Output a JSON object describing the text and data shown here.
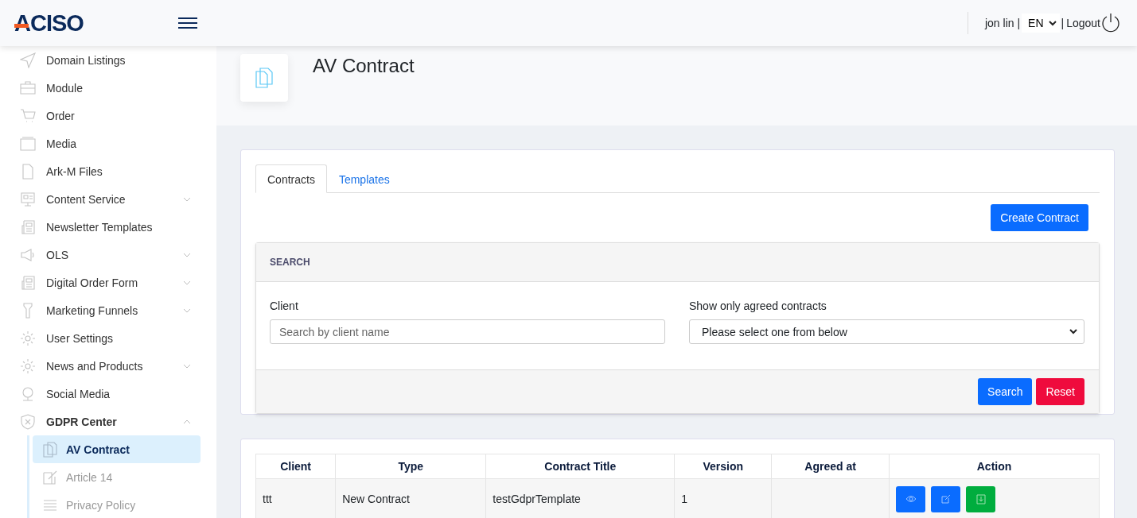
{
  "header": {
    "logo": "ACISO",
    "user": "jon lin |",
    "language": "EN",
    "separator": "|",
    "logout": "Logout"
  },
  "sidebar": {
    "items": [
      {
        "label": "Domain Listings"
      },
      {
        "label": "Module"
      },
      {
        "label": "Order"
      },
      {
        "label": "Media"
      },
      {
        "label": "Ark-M Files"
      },
      {
        "label": "Content Service",
        "expanded": false
      },
      {
        "label": "Newsletter Templates"
      },
      {
        "label": "OLS",
        "expanded": false
      },
      {
        "label": "Digital Order Form",
        "expanded": false
      },
      {
        "label": "Marketing Funnels",
        "expanded": false
      },
      {
        "label": "User Settings"
      },
      {
        "label": "News and Products",
        "expanded": false
      },
      {
        "label": "Social Media"
      },
      {
        "label": "GDPR Center",
        "expanded": true,
        "children": [
          {
            "label": "AV Contract",
            "selected": true
          },
          {
            "label": "Article 14",
            "selected": false
          },
          {
            "label": "Privacy Policy",
            "selected": false
          }
        ]
      }
    ]
  },
  "page": {
    "title": "AV Contract"
  },
  "tabs": [
    {
      "label": "Contracts",
      "selected": true
    },
    {
      "label": "Templates",
      "selected": false
    }
  ],
  "create_button": "Create Contract",
  "search": {
    "title": "SEARCH",
    "client_label": "Client",
    "client_placeholder": "Search by client name",
    "agreed_label": "Show only agreed contracts",
    "agreed_value": "Please select one from below",
    "search_button": "Search",
    "reset_button": "Reset"
  },
  "table": {
    "columns": [
      "Client",
      "Type",
      "Contract Title",
      "Version",
      "Agreed at",
      "Action"
    ],
    "rows": [
      {
        "client": "ttt",
        "type": "New Contract",
        "title": "testGdprTemplate",
        "version": "1",
        "agreed_at": ""
      }
    ]
  }
}
